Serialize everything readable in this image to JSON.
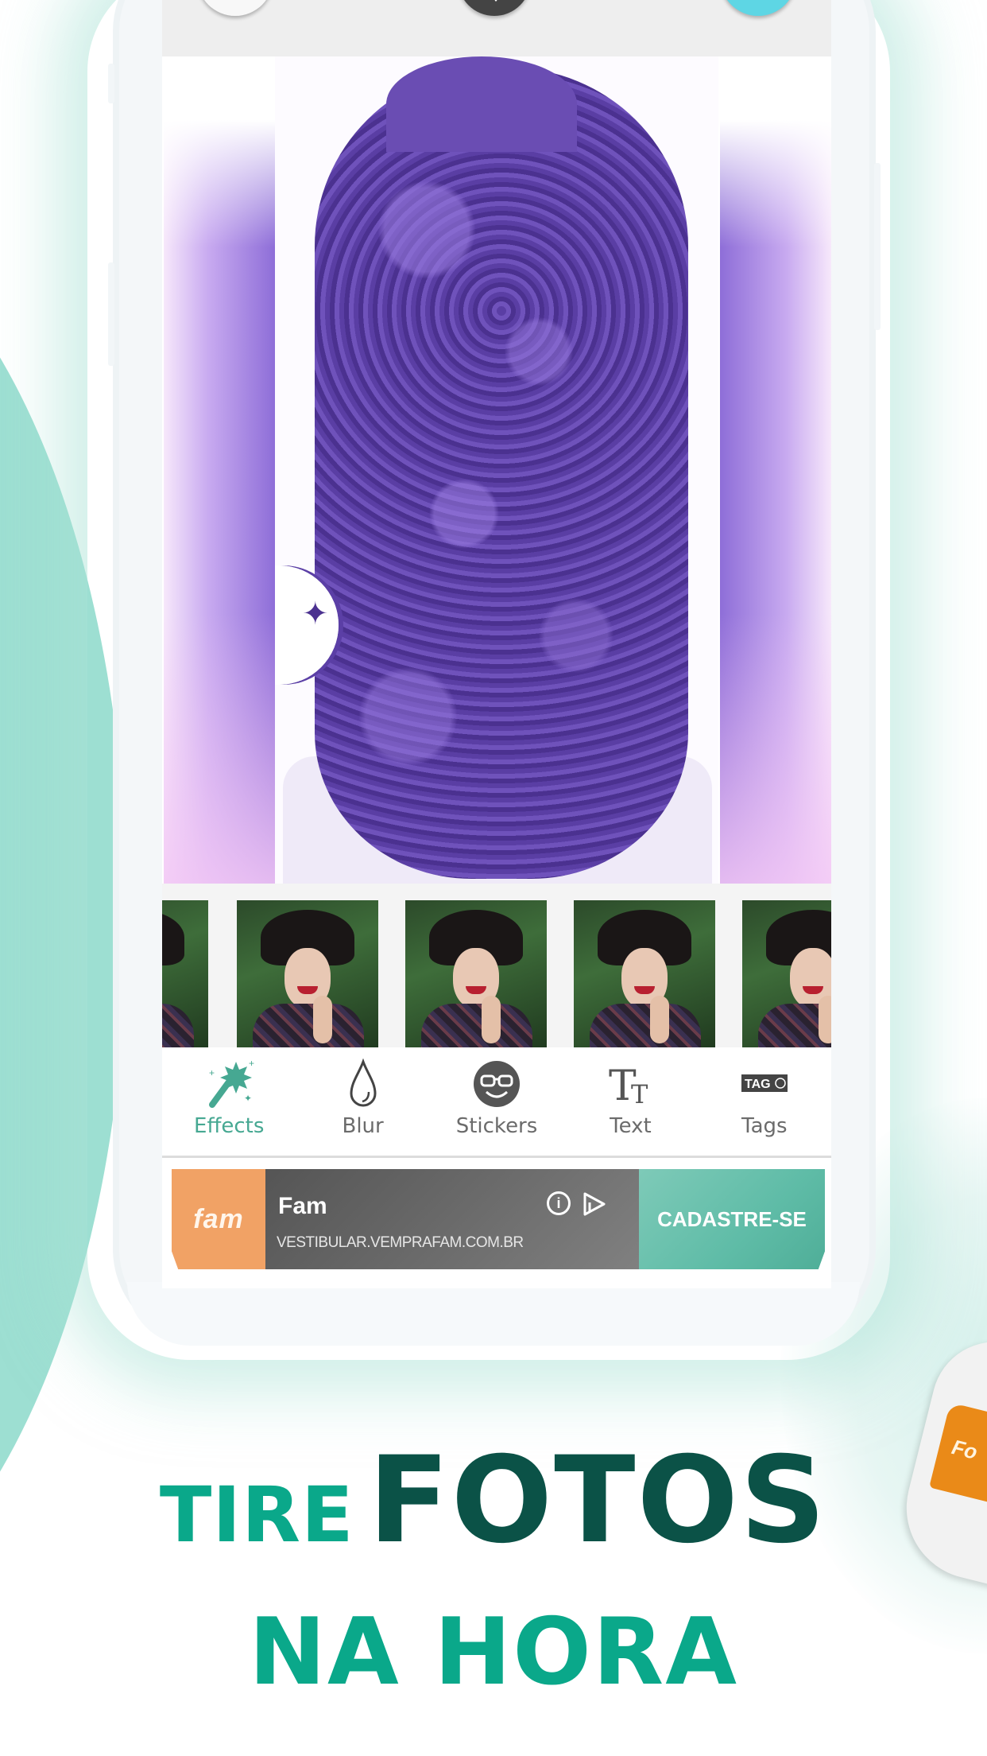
{
  "top_toolbar": {
    "buttons": [
      {
        "icon": "circle-white-button",
        "color": "#f8f8f8"
      },
      {
        "icon": "share-arrow-button",
        "color": "#444444"
      },
      {
        "icon": "save-button",
        "color": "#5ed6e4"
      }
    ]
  },
  "editor": {
    "photo_description": "Back view of woman with long curly purple-tinted hair",
    "filter_thumbnails": [
      {
        "label": "filter-1"
      },
      {
        "label": "filter-2"
      },
      {
        "label": "filter-3"
      },
      {
        "label": "filter-4"
      },
      {
        "label": "filter-5"
      }
    ],
    "tools": [
      {
        "id": "effects",
        "label": "Effects",
        "icon": "magic-wand-icon",
        "active": true
      },
      {
        "id": "blur",
        "label": "Blur",
        "icon": "droplet-icon",
        "active": false
      },
      {
        "id": "stickers",
        "label": "Stickers",
        "icon": "smiley-glasses-icon",
        "active": false
      },
      {
        "id": "text",
        "label": "Text",
        "icon": "text-tt-icon",
        "active": false
      },
      {
        "id": "tags",
        "label": "Tags",
        "icon": "tag-icon",
        "active": false
      }
    ],
    "tags_icon_text": "TAG",
    "text_icon_glyph": "TT",
    "accent_color": "#46a892"
  },
  "ad": {
    "logo_text": "fam",
    "title": "Fam",
    "url": "VESTIBULAR.VEMPRAFAM.COM.BR",
    "info_glyph": "i",
    "cta_label": "CADASTRE-SE",
    "colors": {
      "logo_bg": "#f1a265",
      "body_bg": "#666666",
      "cta_bg": "#5fbca7"
    }
  },
  "headline": {
    "line1_word1": "TIRE",
    "line1_word2": "FOTOS",
    "line2": "NA HORA",
    "colors": {
      "primary": "#0aa88a",
      "dark": "#0b5247"
    }
  },
  "secondary_phone": {
    "logo_text": "Fo"
  }
}
